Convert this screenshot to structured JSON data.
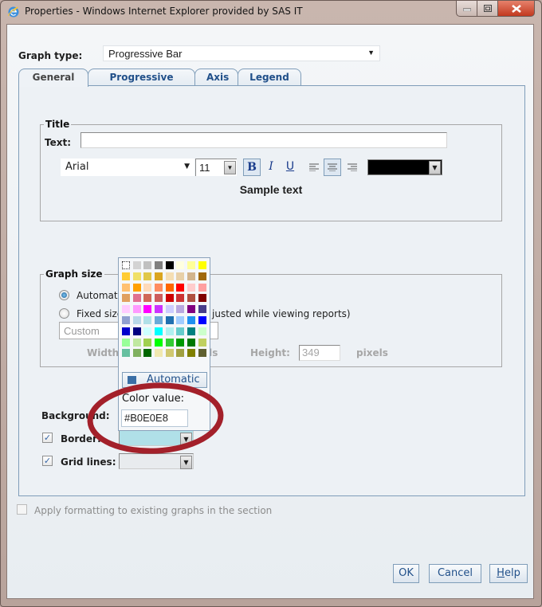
{
  "window": {
    "title": "Properties - Windows Internet Explorer provided by SAS IT",
    "icon": "internet-explorer-icon",
    "controls": [
      "minimize",
      "maximize",
      "close"
    ]
  },
  "graph_type": {
    "label": "Graph type:",
    "value": "Progressive Bar"
  },
  "tabs": [
    {
      "label": "General",
      "active": true
    },
    {
      "label": "Progressive Bar",
      "active": false
    },
    {
      "label": "Axis",
      "active": false
    },
    {
      "label": "Legend",
      "active": false
    }
  ],
  "title_group": {
    "legend": "Title",
    "text_label": "Text:",
    "text_value": "",
    "font": "Arial",
    "size": "11",
    "bold": true,
    "italic": false,
    "underline": false,
    "alignment": "center",
    "color": "#000000",
    "sample": "Sample text"
  },
  "size_group": {
    "legend": "Graph size",
    "auto_label": "Automatic",
    "fixed_label_start": "Fixed size",
    "fixed_label_end": "justed while viewing reports)",
    "selected": "auto",
    "preset": "Custom",
    "width_label": "Width:",
    "pixels_label_1": "els",
    "height_label": "Height:",
    "height_value": "349",
    "pixels_label_2": "pixels"
  },
  "background": {
    "label": "Background:",
    "border_label": "Border:",
    "border_checked": true,
    "border_color": "#B0E0E8",
    "grid_label": "Grid lines:",
    "grid_checked": true
  },
  "color_popup": {
    "swatches": [
      "none",
      "#d3d3d3",
      "#c0c0c0",
      "#808080",
      "#000000",
      "#ffffe0",
      "#ffff99",
      "#ffff00",
      "#ffcc33",
      "#f0e068",
      "#e0c848",
      "#daa520",
      "#f5deb3",
      "#e8d0a8",
      "#d2b48c",
      "#a0680a",
      "#ffc070",
      "#ffa000",
      "#ffdab9",
      "#ff8c60",
      "#ff6600",
      "#ff0000",
      "#ffcccc",
      "#ffa0a0",
      "#e0a060",
      "#e07090",
      "#d06858",
      "#cd5c5c",
      "#cc0000",
      "#cc3333",
      "#b05040",
      "#800000",
      "#ffccff",
      "#ff99ff",
      "#ff00ff",
      "#cc33ff",
      "#ccccff",
      "#b8a8e0",
      "#800080",
      "#483d8b",
      "#90a0d0",
      "#b8d8e8",
      "#b0e0e8",
      "#6aaad8",
      "#2070b0",
      "#a0ccff",
      "#2090f0",
      "#0000ff",
      "#0000cc",
      "#000080",
      "#ccffff",
      "#00ffff",
      "#b0f0f0",
      "#66cccc",
      "#008080",
      "#ccffcc",
      "#99ff99",
      "#c0e8a0",
      "#a0d050",
      "#00ff00",
      "#33cc33",
      "#009900",
      "#007700",
      "#c0d060",
      "#66c0a0",
      "#80b060",
      "#006600",
      "#f0e8b0",
      "#d0c870",
      "#a0a040",
      "#808000",
      "#606030"
    ],
    "automatic_label": "Automatic",
    "color_value_label": "Color value:",
    "color_value": "#B0E0E8"
  },
  "apply": {
    "label": "Apply formatting to existing graphs in the section",
    "checked": false,
    "enabled": false
  },
  "buttons": {
    "ok": "OK",
    "cancel": "Cancel",
    "help": "Help"
  },
  "annotation": {
    "type": "ellipse",
    "color": "#a3202a"
  }
}
